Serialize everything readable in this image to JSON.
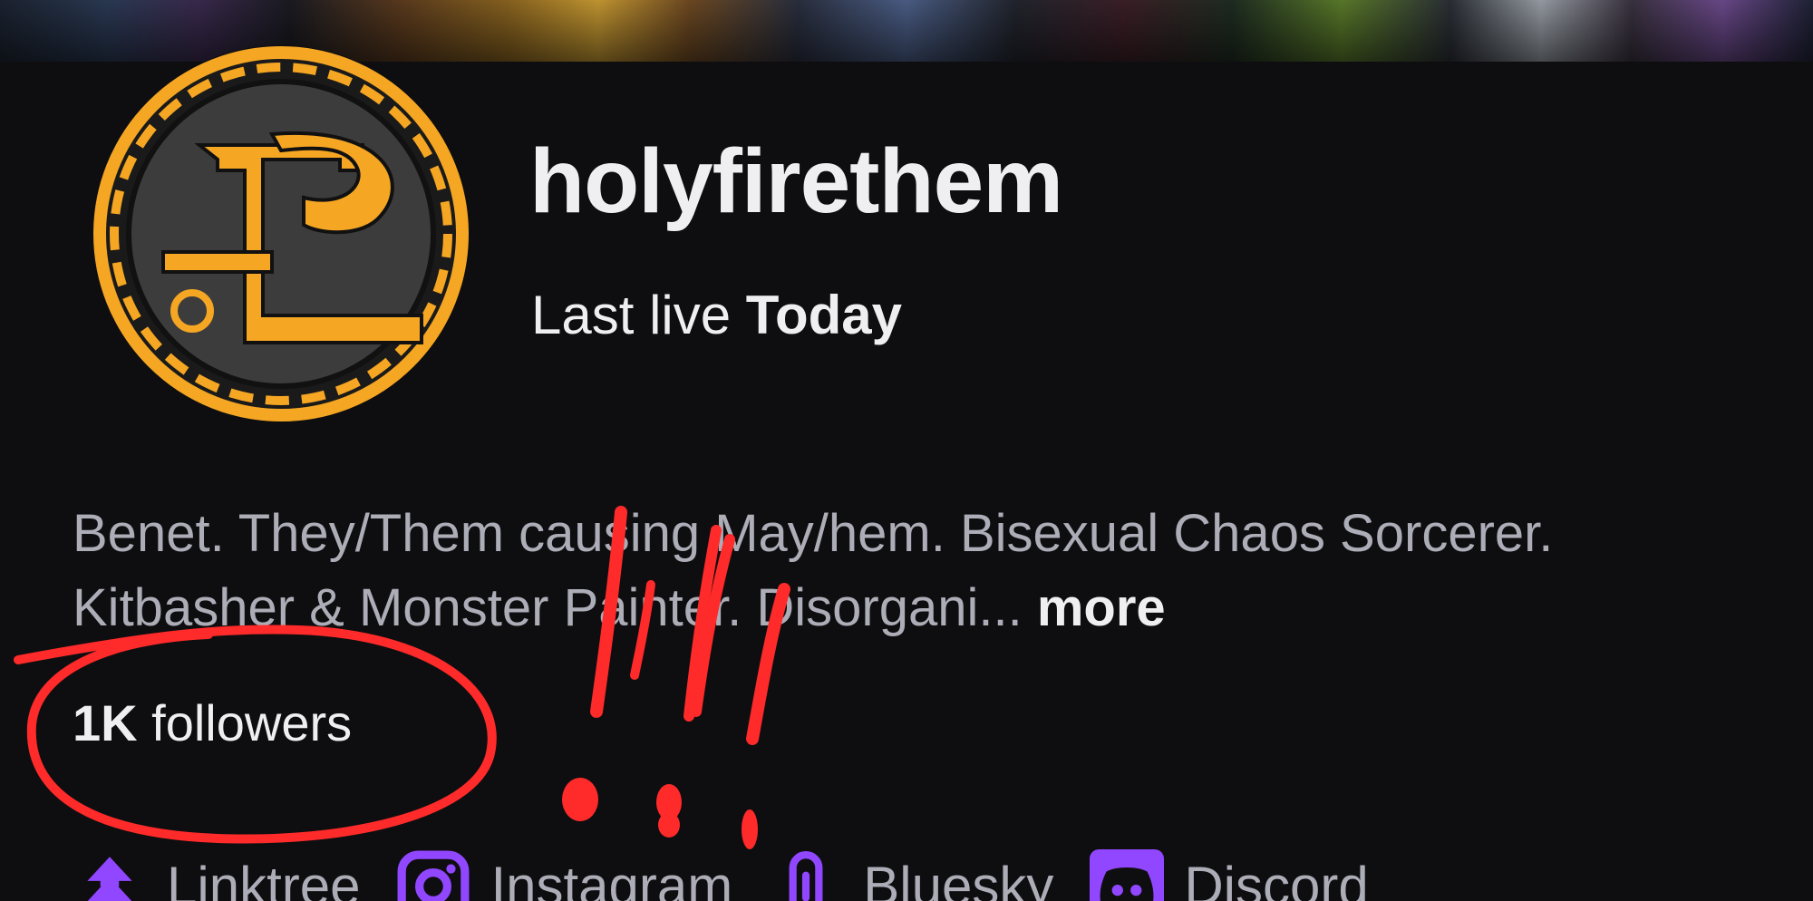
{
  "channel": {
    "username": "holyfirethem",
    "last_live_prefix": "Last live",
    "last_live_value": "Today",
    "avatar_icon": "channel-logo-icon",
    "avatar_colors": {
      "ring": "#f5a623",
      "inner": "#3c3c3c"
    }
  },
  "bio": {
    "text": "Benet. They/Them causing May/hem. Bisexual Chaos Sorcerer. Kitbasher & Monster Painter. Disorgani...",
    "more_label": "more"
  },
  "followers": {
    "count": "1K",
    "label": "followers"
  },
  "socials": [
    {
      "label": "Linktree",
      "icon": "linktree-icon"
    },
    {
      "label": "Instagram",
      "icon": "instagram-icon"
    },
    {
      "label": "Bluesky",
      "icon": "link-icon"
    },
    {
      "label": "Discord",
      "icon": "discord-icon"
    }
  ],
  "theme": {
    "background": "#0e0e10",
    "accent_purple": "#9147ff",
    "text_primary": "#efeff1",
    "text_secondary": "#adadb8",
    "annotation_red": "#ff2a2a"
  }
}
